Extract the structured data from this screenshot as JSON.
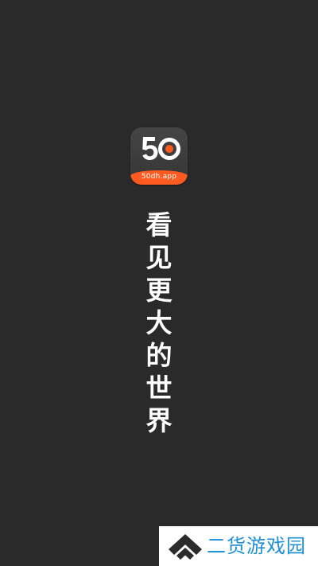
{
  "splash": {
    "app_icon": {
      "logo_number": "50",
      "domain_label": "50dh.app",
      "brand_color": "#ff5a1f",
      "icon_name": "app-logo-icon"
    },
    "slogan": "看见更大的世界",
    "background_color": "#2a2a2a"
  },
  "watermark": {
    "text": "二货游戏园",
    "icon_name": "chevron-up-logo-icon",
    "color": "#1f8fd6"
  }
}
